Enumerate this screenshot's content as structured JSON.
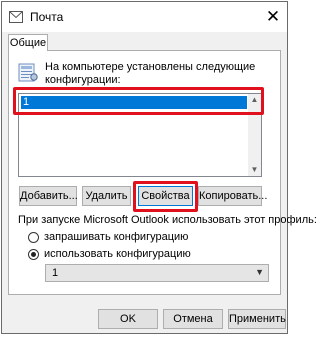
{
  "window": {
    "title": "Почта",
    "close_glyph": "✕"
  },
  "tabs": [
    {
      "label": "Общие"
    }
  ],
  "general": {
    "info_line1": "На компьютере установлены следующие",
    "info_line2": "конфигурации:",
    "profiles": [
      {
        "name": "1",
        "selected": true
      }
    ],
    "buttons": {
      "add": "Добавить...",
      "remove": "Удалить",
      "properties": "Свойства",
      "copy": "Копировать..."
    },
    "startup_label": "При запуске Microsoft Outlook использовать этот профиль:",
    "radio_prompt": "запрашивать конфигурацию",
    "radio_use": "использовать конфигурацию",
    "selected_radio": "use",
    "dropdown_value": "1"
  },
  "footer": {
    "ok": "OK",
    "cancel": "Отмена",
    "apply": "Применить"
  },
  "colors": {
    "highlight": "#e0101c",
    "selection": "#0078d7"
  },
  "icons": {
    "title": "mail-icon",
    "profile": "profile-icon",
    "close": "close-icon"
  }
}
